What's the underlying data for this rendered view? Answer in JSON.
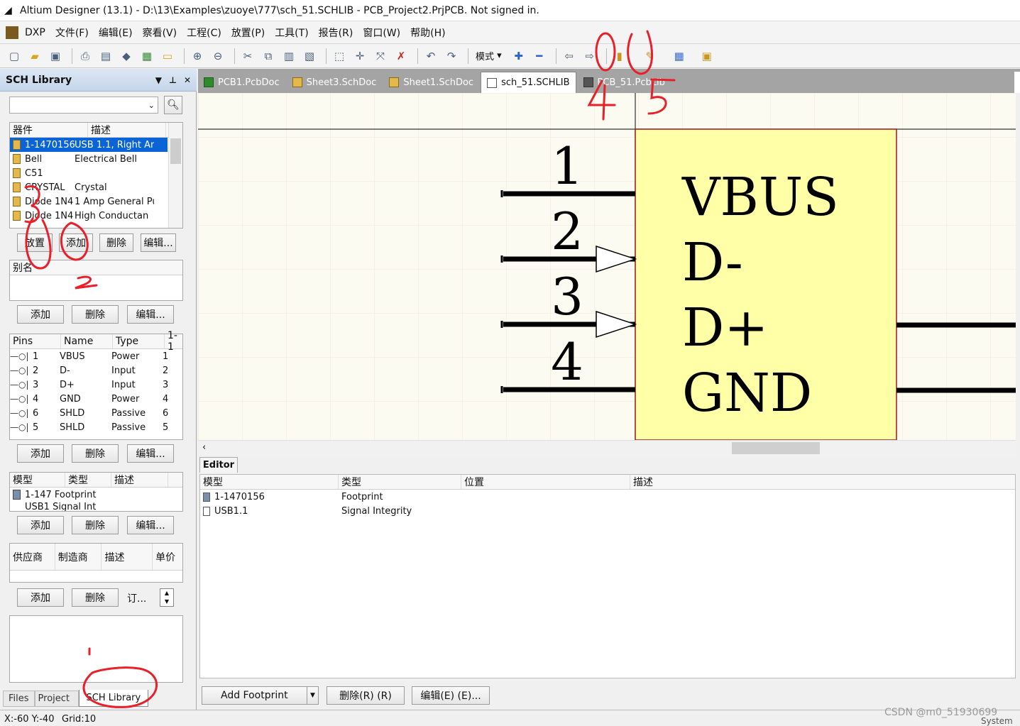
{
  "window": {
    "title": "Altium Designer (13.1) - D:\\13\\Examples\\zuoye\\777\\sch_51.SCHLIB - PCB_Project2.PrjPCB. Not signed in."
  },
  "menu": [
    "DXP",
    "文件(F)",
    "编辑(E)",
    "察看(V)",
    "工程(C)",
    "放置(P)",
    "工具(T)",
    "报告(R)",
    "窗口(W)",
    "帮助(H)"
  ],
  "toolbar": {
    "mode_label": "模式"
  },
  "left_panel": {
    "title": "SCH Library",
    "components_header": {
      "col1": "器件",
      "col2": "描述"
    },
    "components": [
      {
        "name": "1-1470156-",
        "desc": "USB 1.1, Right An",
        "selected": true
      },
      {
        "name": "Bell",
        "desc": "Electrical Bell"
      },
      {
        "name": "C51",
        "desc": ""
      },
      {
        "name": "CRYSTAL",
        "desc": "Crystal"
      },
      {
        "name": "Diode 1N4",
        "desc": "1 Amp General Pu"
      },
      {
        "name": "Diode 1N4",
        "desc": "High Conductan"
      }
    ],
    "comp_buttons": [
      "放置",
      "添加",
      "删除",
      "编辑..."
    ],
    "alias_header": "别名",
    "alias_buttons": [
      "添加",
      "删除",
      "编辑..."
    ],
    "pins_header": {
      "c1": "Pins",
      "c2": "Name",
      "c3": "Type",
      "c4": "1-1"
    },
    "pins": [
      {
        "num": "1",
        "name": "VBUS",
        "type": "Power",
        "ext": "1"
      },
      {
        "num": "2",
        "name": "D-",
        "type": "Input",
        "ext": "2"
      },
      {
        "num": "3",
        "name": "D+",
        "type": "Input",
        "ext": "3"
      },
      {
        "num": "4",
        "name": "GND",
        "type": "Power",
        "ext": "4"
      },
      {
        "num": "6",
        "name": "SHLD",
        "type": "Passive",
        "ext": "6"
      },
      {
        "num": "5",
        "name": "SHLD",
        "type": "Passive",
        "ext": "5"
      }
    ],
    "pin_buttons": [
      "添加",
      "删除",
      "编辑..."
    ],
    "models_header": {
      "c1": "模型",
      "c2": "类型",
      "c3": "描述"
    },
    "models": [
      {
        "name": "1-147",
        "type": "Footprint"
      },
      {
        "name": "USB1",
        "type": "Signal Int"
      }
    ],
    "model_buttons": [
      "添加",
      "删除",
      "编辑..."
    ],
    "supplier_header": {
      "c1": "供应商",
      "c2": "制造商",
      "c3": "描述",
      "c4": "单价"
    },
    "supplier_buttons": [
      "添加",
      "删除",
      "订..."
    ],
    "bottom_tabs": [
      "Files",
      "Project",
      "SCH Library"
    ]
  },
  "doc_tabs": [
    "PCB1.PcbDoc",
    "Sheet3.SchDoc",
    "Sheet1.SchDoc",
    "sch_51.SCHLIB",
    "PCB_51.PcbLib"
  ],
  "schematic": {
    "pins": [
      {
        "num": "1",
        "label": "VBUS"
      },
      {
        "num": "2",
        "label": "D-"
      },
      {
        "num": "3",
        "label": "D+"
      },
      {
        "num": "4",
        "label": "GND"
      }
    ]
  },
  "editor": {
    "tab": "Editor",
    "headers": [
      "模型",
      "类型",
      "位置",
      "描述"
    ],
    "rows": [
      {
        "model": "1-1470156",
        "type": "Footprint"
      },
      {
        "model": "USB1.1",
        "type": "Signal Integrity"
      }
    ],
    "buttons": {
      "add_footprint": "Add Footprint",
      "delete": "删除(R) (R)",
      "edit": "编辑(E) (E)..."
    }
  },
  "status": {
    "coords": "X:-60 Y:-40",
    "grid": "Grid:10",
    "system": "System",
    "watermark": "CSDN @m0_51930699"
  },
  "annotations": [
    "1",
    "2",
    "3",
    "4",
    "5"
  ]
}
